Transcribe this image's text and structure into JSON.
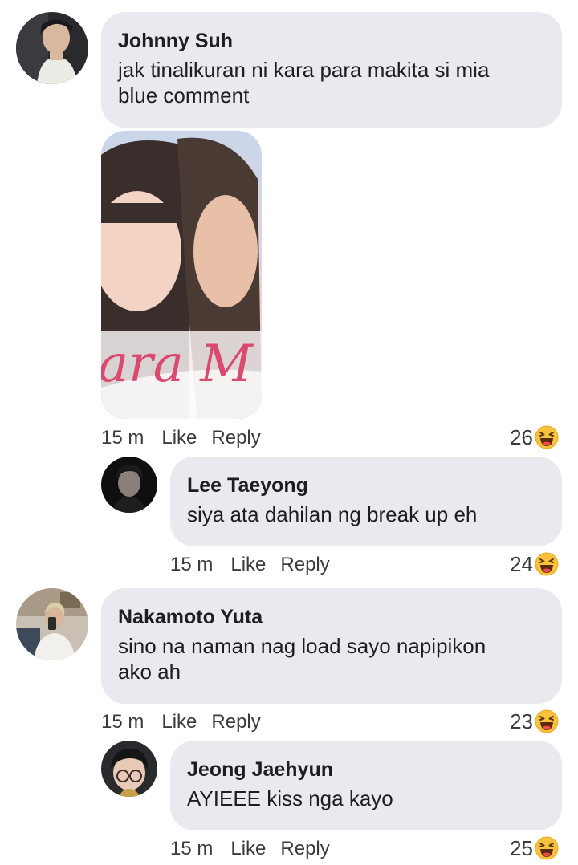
{
  "comments": [
    {
      "author": "Johnny Suh",
      "text": "jak tinalikuran ni kara para makita si mia\nblue comment",
      "time": "15 m",
      "like": "Like",
      "reply": "Reply",
      "reactions": "26",
      "reaction_icon": "haha-emoji-icon",
      "attachment_text": "ara M"
    },
    {
      "author": "Lee Taeyong",
      "text": "siya ata dahilan ng break up eh",
      "time": "15 m",
      "like": "Like",
      "reply": "Reply",
      "reactions": "24",
      "reaction_icon": "haha-emoji-icon"
    },
    {
      "author": "Nakamoto Yuta",
      "text": "sino na naman nag load sayo napipikon\nako ah",
      "time": "15 m",
      "like": "Like",
      "reply": "Reply",
      "reactions": "23",
      "reaction_icon": "haha-emoji-icon"
    },
    {
      "author": "Jeong Jaehyun",
      "text": "AYIEEE kiss nga kayo",
      "time": "15 m",
      "like": "Like",
      "reply": "Reply",
      "reactions": "25",
      "reaction_icon": "haha-emoji-icon"
    }
  ],
  "colors": {
    "bubble": "#e9eaf0",
    "text": "#1c1e21",
    "meta": "#3a3b3e",
    "emoji_face": "#fbc540"
  }
}
